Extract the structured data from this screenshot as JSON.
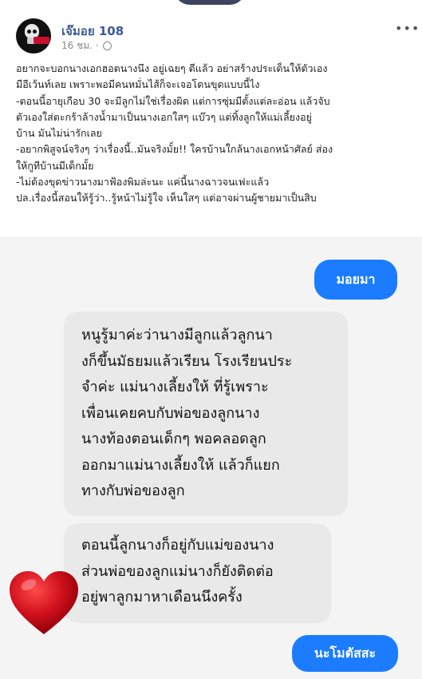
{
  "post": {
    "author": "เจ๊มอย 108",
    "time": "16 ชม. ·",
    "lines": [
      "อยากจะบอกนางเอกฮอตนางนึง อยู่เฉยๆ ดีแล้ว อย่าสร้างประเด็นให้ตัวเอง",
      "มีอีเว้นท์เลย เพราะพอมีคนหมั่นไส้ก็จะเจอโดนขุดแบบนี้ไง",
      "-ตอนนี้อายุเกือบ 30 จะมีลูกไม่ใช่เรื่องผิด แต่การซุ่มมีตั้งแต่ละอ่อน แล้วจับ",
      "ตัวเองใส่ตะกร้าล้างน้ำมาเป็นนางเอกใสๆ แบ๊วๆ แต่ทิ้งลูกให้แม่เลี้ยงอยู่",
      "บ้าน มันไม่น่ารักเลย",
      "-อยากพิสูจน์จริงๆ ว่าเรื่องนี้..มันจริงมั้ย!! ใครบ้านใกล้นางเอกหน้าศัลย์ ส่อง",
      "ให้กูทีบ้านมีเด็กมั้ย",
      "-ไม่ต้องขุดข่าวนางมาฟ้องพิมล่ะนะ แค่นี้นางฉาวจนเฟะแล้ว",
      "ปล.เรื่องนี้สอนให้รู้ว่า..รู้หน้าไม่รู้ใจ เห็นใสๆ แต่อาจผ่านผู้ชายมาเป็นสิบ"
    ]
  },
  "chat": {
    "sent_1": "มอยมา",
    "received_1": [
      "หนูรู้มาค่ะว่านางมีลูกแล้วลูกนา",
      "งก็ขึ้นมัธยมแล้วเรียน โรงเรียนประ",
      "จำค่ะ แม่นางเลี้ยงให้ ที่รู้เพราะ",
      "เพื่อนเคยคบกับพ่อของลูกนาง",
      "นางท้องตอนเด็กๆ พอคลอดลูก",
      "ออกมาแม่นางเลี้ยงให้ แล้วก็แยก",
      "ทางกับพ่อของลูก"
    ],
    "received_2": [
      "ตอนนี้ลูกนางก็อยู่กับแม่ของนาง",
      "ส่วนพ่อของลูกแม่นางก็ยังติดต่อ",
      "อยู่พาลูกมาหาเดือนนึงครั้ง"
    ],
    "sent_2": "นะโมตัสสะ"
  },
  "colors": {
    "link": "#3b5998",
    "sent_bubble": "#1b7cff",
    "received_bubble": "#e9e9ea",
    "heart": "#d0101c"
  },
  "icons": {
    "globe": "globe-icon",
    "more": "more-options-icon",
    "heart": "heart-icon"
  }
}
